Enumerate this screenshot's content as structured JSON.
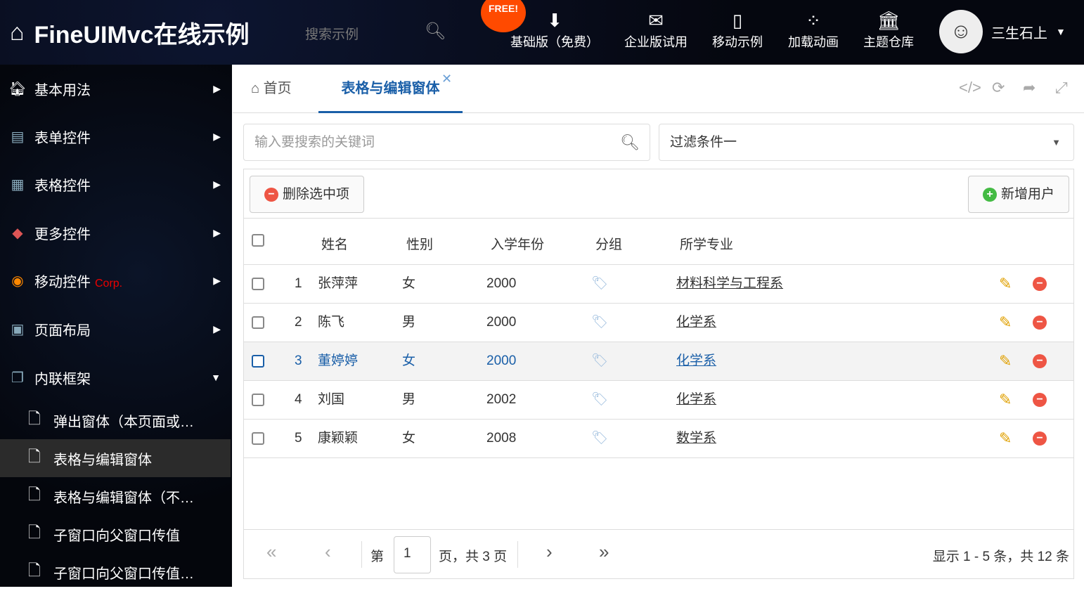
{
  "header": {
    "title": "FineUIMvc在线示例",
    "search_placeholder": "搜索示例",
    "free_badge": "FREE!",
    "nav": [
      {
        "label": "基础版（免费）",
        "icon": "download-icon"
      },
      {
        "label": "企业版试用",
        "icon": "envelope-icon"
      },
      {
        "label": "移动示例",
        "icon": "mobile-icon"
      },
      {
        "label": "加载动画",
        "icon": "spinner-icon"
      },
      {
        "label": "主题仓库",
        "icon": "bank-icon"
      }
    ],
    "user": "三生石上"
  },
  "sidebar": {
    "items": [
      {
        "label": "基本用法"
      },
      {
        "label": "表单控件"
      },
      {
        "label": "表格控件"
      },
      {
        "label": "更多控件"
      },
      {
        "label": "移动控件",
        "badge": "Corp."
      },
      {
        "label": "页面布局"
      },
      {
        "label": "内联框架"
      }
    ],
    "children": [
      {
        "label": "弹出窗体（本页面或…"
      },
      {
        "label": "表格与编辑窗体",
        "selected": true
      },
      {
        "label": "表格与编辑窗体（不…"
      },
      {
        "label": "子窗口向父窗口传值"
      },
      {
        "label": "子窗口向父窗口传值…"
      }
    ]
  },
  "tabs": [
    {
      "label": "首页"
    },
    {
      "label": "表格与编辑窗体",
      "active": true
    }
  ],
  "search": {
    "placeholder": "输入要搜索的关键词",
    "filter": "过滤条件一"
  },
  "toolbar": {
    "delete": "删除选中项",
    "add": "新增用户"
  },
  "table": {
    "columns": [
      "姓名",
      "性别",
      "入学年份",
      "分组",
      "所学专业"
    ],
    "rows": [
      {
        "n": "1",
        "name": "张萍萍",
        "sex": "女",
        "year": "2000",
        "major": "材料科学与工程系"
      },
      {
        "n": "2",
        "name": "陈飞",
        "sex": "男",
        "year": "2000",
        "major": "化学系"
      },
      {
        "n": "3",
        "name": "董婷婷",
        "sex": "女",
        "year": "2000",
        "major": "化学系"
      },
      {
        "n": "4",
        "name": "刘国",
        "sex": "男",
        "year": "2002",
        "major": "化学系"
      },
      {
        "n": "5",
        "name": "康颖颖",
        "sex": "女",
        "year": "2008",
        "major": "数学系"
      }
    ]
  },
  "pager": {
    "prefix": "第",
    "page": "1",
    "suffix": "页，共 3 页",
    "summary": "显示 1 - 5 条，共 12 条"
  },
  "colors": {
    "accent": "#1a5fa8",
    "badge": "#ff4a00"
  }
}
